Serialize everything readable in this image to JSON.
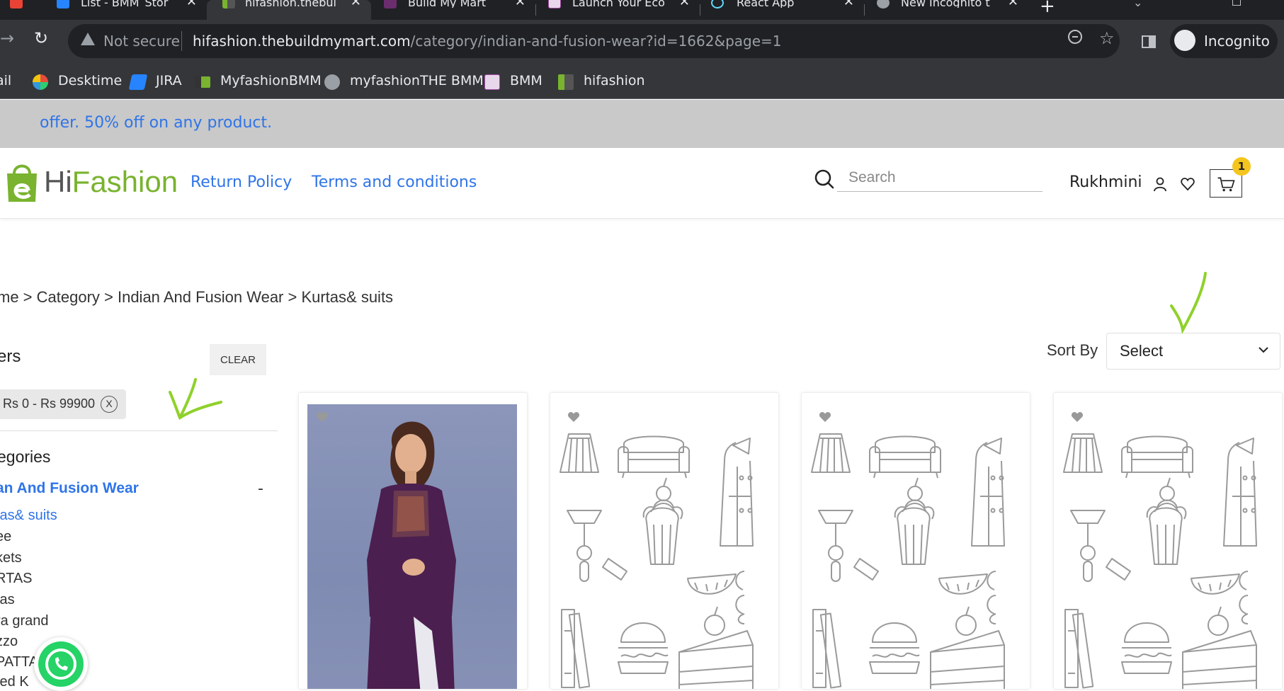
{
  "browser": {
    "tabs": [
      {
        "label": "List - BMM_Stor",
        "icon": "jira-icon",
        "active": false
      },
      {
        "label": "hifashion.thebuil",
        "icon": "hifashion-icon",
        "active": true
      },
      {
        "label": "Build My Mart",
        "icon": "bmm-icon",
        "active": false
      },
      {
        "label": "Launch Your Eco",
        "icon": "bmm-icon",
        "active": false
      },
      {
        "label": "React App",
        "icon": "react-icon",
        "active": false
      },
      {
        "label": "New Incognito t",
        "icon": "incognito-icon",
        "active": false
      }
    ],
    "new_tab": "+",
    "close_glyph": "✕",
    "security_label": "Not secure",
    "url_host": "hifashion.thebuildmymart.com",
    "url_path": "/category/indian-and-fusion-wear?id=1662&page=1",
    "profile_label": "Incognito",
    "bookmarks": [
      {
        "label": "ail",
        "icon": "gmail-icon"
      },
      {
        "label": "Desktime",
        "icon": "desktime-icon"
      },
      {
        "label": "JIRA",
        "icon": "jira-icon"
      },
      {
        "label": "MyfashionBMM",
        "icon": "myfashion-icon"
      },
      {
        "label": "myfashionTHE BMM",
        "icon": "globe-icon"
      },
      {
        "label": "BMM",
        "icon": "bmm-icon"
      },
      {
        "label": "hifashion",
        "icon": "hifashion-icon"
      }
    ]
  },
  "site": {
    "offer_text": "offer. 50% off on any product.",
    "logo": {
      "hi": "Hi",
      "fashion": "Fashion"
    },
    "nav": {
      "return_policy": "Return Policy",
      "terms": "Terms and conditions"
    },
    "search_placeholder": "Search",
    "username": "Rukhmini",
    "cart_count": "1",
    "breadcrumb": "me > Category > Indian And Fusion Wear > Kurtas& suits",
    "filters": {
      "title": "ers",
      "clear_label": "CLEAR",
      "price_chip": "Rs 0 - Rs 99900",
      "chip_close": "X",
      "categories_title": "egories",
      "main_category": "an And Fusion Wear",
      "main_toggle": "-",
      "subcategories": [
        "tas& suits",
        "ee",
        "kets",
        "RTAS",
        "tas",
        "ra grand",
        "zzo",
        "PATTA",
        "ted K"
      ]
    },
    "sort": {
      "label": "Sort By",
      "value": "Select"
    },
    "products": [
      {
        "image": "kurta-photo"
      },
      {
        "image": "placeholder-doodle"
      },
      {
        "image": "placeholder-doodle"
      },
      {
        "image": "placeholder-doodle"
      }
    ]
  },
  "colors": {
    "accent_blue": "#2f74e8",
    "brand_green": "#79b32f",
    "annotation_green": "#8fd12a",
    "badge_yellow": "#f4c51d"
  }
}
